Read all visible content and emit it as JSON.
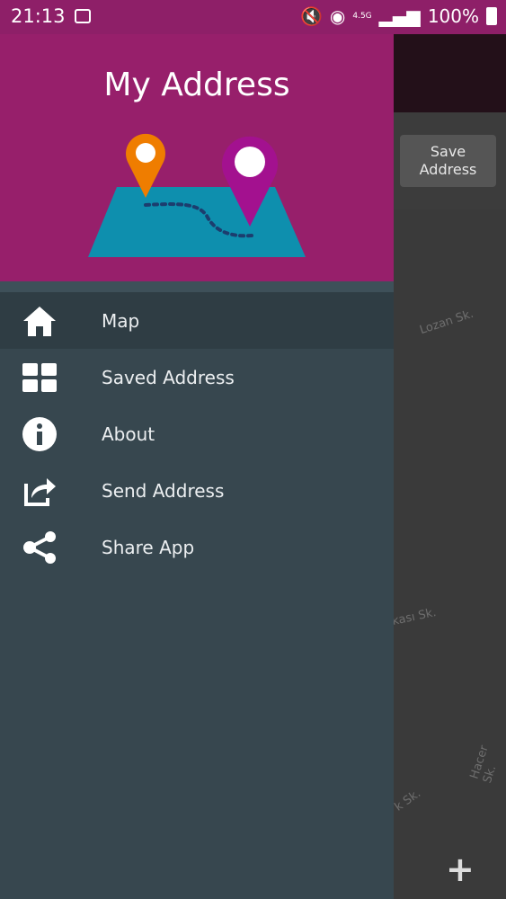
{
  "status_bar": {
    "time": "21:13",
    "network": "4.5G",
    "battery": "100%"
  },
  "drawer": {
    "title": "My Address",
    "items": [
      {
        "label": "Map",
        "icon": "home-icon",
        "active": true
      },
      {
        "label": "Saved Address",
        "icon": "grid-icon",
        "active": false
      },
      {
        "label": "About",
        "icon": "info-icon",
        "active": false
      },
      {
        "label": "Send Address",
        "icon": "share-arrow-icon",
        "active": false
      },
      {
        "label": "Share App",
        "icon": "share-icon",
        "active": false
      }
    ]
  },
  "background": {
    "save_button_label": "Save\nAddress",
    "streets": [
      "Lozan Sk.",
      "kası Sk.",
      "Hacer Sk.",
      "k Sk."
    ]
  },
  "colors": {
    "header": "#971f6b",
    "status_bar": "#8e1f68",
    "drawer_bg": "#37474f",
    "active_item": "#2f3d44",
    "pin_orange": "#ef7d00",
    "pin_purple": "#a3118f",
    "map_teal": "#0e8fae"
  }
}
